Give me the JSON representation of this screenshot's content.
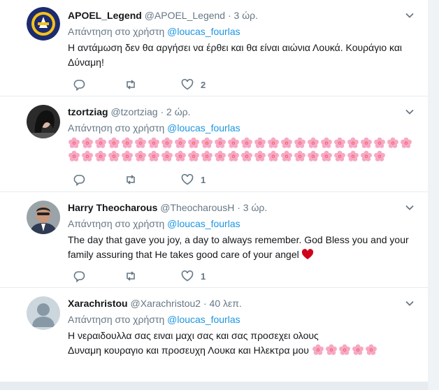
{
  "reply_prefix": "Απάντηση στο χρήστη",
  "tweets": [
    {
      "name": "APOEL_Legend",
      "handle": "@APOEL_Legend",
      "time": "3 ώρ.",
      "mention": "@loucas_fourlas",
      "text": "Η αντάμωση δεν θα αργήσει να έρθει και θα είναι αιώνια Λουκά. Κουράγιο και Δύναμη!",
      "like_count": "2",
      "avatar": "apoel-crest"
    },
    {
      "name": "tzortziag",
      "handle": "@tzortziag",
      "time": "2 ώρ.",
      "mention": "@loucas_fourlas",
      "text": "",
      "flowers_line1": 26,
      "flowers_line2": 24,
      "like_count": "1",
      "avatar": "photo-woman"
    },
    {
      "name": "Harry Theocharous",
      "handle": "@TheocharousH",
      "time": "3 ώρ.",
      "mention": "@loucas_fourlas",
      "text": "The day that gave you joy, a day to always remember. God Bless you and your family assuring that He takes good care of your angel",
      "like_count": "1",
      "avatar": "photo-man"
    },
    {
      "name": "Xarachristou",
      "handle": "@Xarachristou2",
      "time": "40 λεπ.",
      "mention": "@loucas_fourlas",
      "text_line1": "Η νεραιδουλλα σας ειναι μαχι σας και σας προσεχει ολους",
      "text_line2": "Δυναμη κουραγιο και προσευχη Λουκα και Ηλεκτρα μου",
      "flowers_after": 5,
      "avatar": "default-egg"
    }
  ],
  "colors": {
    "link": "#1b95e0",
    "secondary": "#657786",
    "heart_red": "#d0021b",
    "flower_pink": "#f7a8c4"
  }
}
